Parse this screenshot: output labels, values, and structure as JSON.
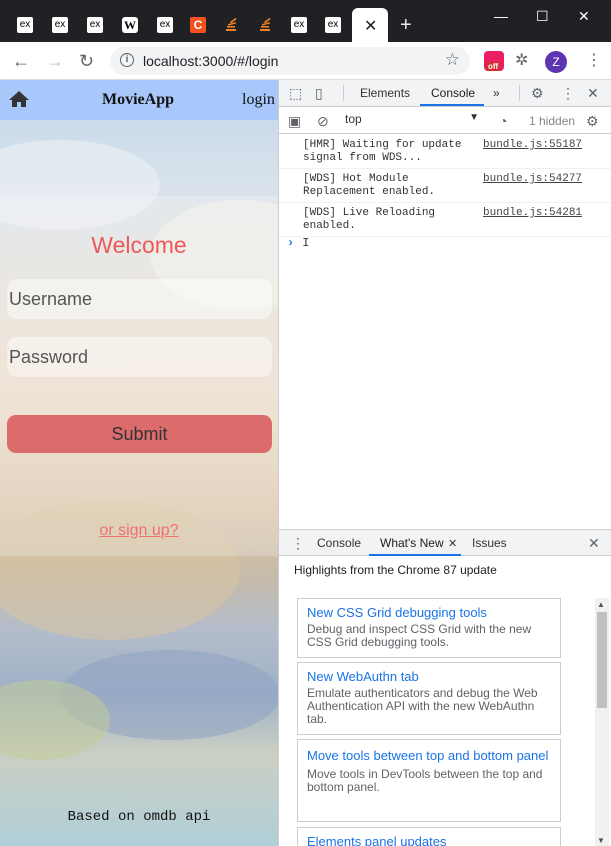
{
  "browser": {
    "tabs": [
      {
        "icon": "ex-icon",
        "label": "ex"
      },
      {
        "icon": "ex-icon",
        "label": "ex"
      },
      {
        "icon": "ex-icon",
        "label": "ex"
      },
      {
        "icon": "wikipedia-icon",
        "label": "W"
      },
      {
        "icon": "ex-icon",
        "label": "ex"
      },
      {
        "icon": "c-icon",
        "label": "C"
      },
      {
        "icon": "stackoverflow-icon",
        "label": ""
      },
      {
        "icon": "stackoverflow-icon",
        "label": ""
      },
      {
        "icon": "ex-icon",
        "label": "ex"
      },
      {
        "icon": "ex-icon",
        "label": "ex"
      }
    ],
    "active_tab_close": "✕",
    "new_tab": "+",
    "url": "localhost:3000/#/login",
    "extension_badge": "off",
    "profile_initial": "Z"
  },
  "app": {
    "brand": "MovieApp",
    "nav_login": "login",
    "welcome": "Welcome",
    "username_placeholder": "Username",
    "password_placeholder": "Password",
    "submit_label": "Submit",
    "signup_link": "or sign up?",
    "footer": "Based on omdb api"
  },
  "devtools": {
    "tabs": [
      "Elements",
      "Console"
    ],
    "active_tab": "Console",
    "more_tabs": "»",
    "context": "top",
    "hidden_count": "1 hidden",
    "logs": [
      {
        "message": "[HMR] Waiting for update signal from WDS...",
        "source": "bundle.js:55187"
      },
      {
        "message": "[WDS] Hot Module Replacement enabled.",
        "source": "bundle.js:54277"
      },
      {
        "message": "[WDS] Live Reloading enabled.",
        "source": "bundle.js:54281"
      }
    ],
    "prompt_symbol": "›",
    "prompt_text": "I",
    "drawer": {
      "tabs": [
        "Console",
        "What's New",
        "Issues"
      ],
      "active_tab": "What's New",
      "highlights_title": "Highlights from the Chrome 87 update",
      "cards": [
        {
          "title": "New CSS Grid debugging tools",
          "desc": "Debug and inspect CSS Grid with the new CSS Grid debugging tools."
        },
        {
          "title": "New WebAuthn tab",
          "desc": "Emulate authenticators and debug the Web Authentication API with the new WebAuthn tab."
        },
        {
          "title": "Move tools between top and bottom panel",
          "desc": "Move tools in DevTools between the top and bottom panel."
        },
        {
          "title": "Elements panel updates",
          "desc": ""
        }
      ]
    }
  }
}
